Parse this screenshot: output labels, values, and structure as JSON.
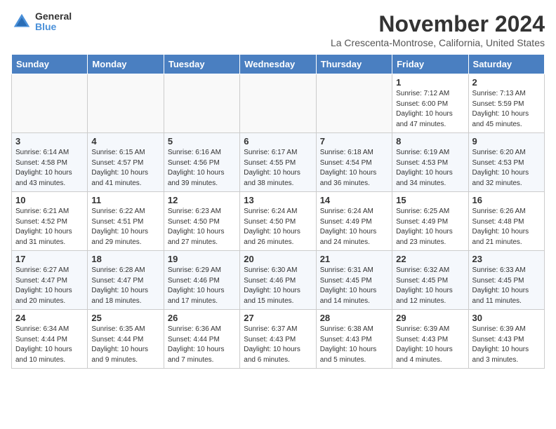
{
  "logo": {
    "general": "General",
    "blue": "Blue"
  },
  "title": "November 2024",
  "subtitle": "La Crescenta-Montrose, California, United States",
  "days_of_week": [
    "Sunday",
    "Monday",
    "Tuesday",
    "Wednesday",
    "Thursday",
    "Friday",
    "Saturday"
  ],
  "weeks": [
    [
      {
        "day": "",
        "info": ""
      },
      {
        "day": "",
        "info": ""
      },
      {
        "day": "",
        "info": ""
      },
      {
        "day": "",
        "info": ""
      },
      {
        "day": "",
        "info": ""
      },
      {
        "day": "1",
        "info": "Sunrise: 7:12 AM\nSunset: 6:00 PM\nDaylight: 10 hours\nand 47 minutes."
      },
      {
        "day": "2",
        "info": "Sunrise: 7:13 AM\nSunset: 5:59 PM\nDaylight: 10 hours\nand 45 minutes."
      }
    ],
    [
      {
        "day": "3",
        "info": "Sunrise: 6:14 AM\nSunset: 4:58 PM\nDaylight: 10 hours\nand 43 minutes."
      },
      {
        "day": "4",
        "info": "Sunrise: 6:15 AM\nSunset: 4:57 PM\nDaylight: 10 hours\nand 41 minutes."
      },
      {
        "day": "5",
        "info": "Sunrise: 6:16 AM\nSunset: 4:56 PM\nDaylight: 10 hours\nand 39 minutes."
      },
      {
        "day": "6",
        "info": "Sunrise: 6:17 AM\nSunset: 4:55 PM\nDaylight: 10 hours\nand 38 minutes."
      },
      {
        "day": "7",
        "info": "Sunrise: 6:18 AM\nSunset: 4:54 PM\nDaylight: 10 hours\nand 36 minutes."
      },
      {
        "day": "8",
        "info": "Sunrise: 6:19 AM\nSunset: 4:53 PM\nDaylight: 10 hours\nand 34 minutes."
      },
      {
        "day": "9",
        "info": "Sunrise: 6:20 AM\nSunset: 4:53 PM\nDaylight: 10 hours\nand 32 minutes."
      }
    ],
    [
      {
        "day": "10",
        "info": "Sunrise: 6:21 AM\nSunset: 4:52 PM\nDaylight: 10 hours\nand 31 minutes."
      },
      {
        "day": "11",
        "info": "Sunrise: 6:22 AM\nSunset: 4:51 PM\nDaylight: 10 hours\nand 29 minutes."
      },
      {
        "day": "12",
        "info": "Sunrise: 6:23 AM\nSunset: 4:50 PM\nDaylight: 10 hours\nand 27 minutes."
      },
      {
        "day": "13",
        "info": "Sunrise: 6:24 AM\nSunset: 4:50 PM\nDaylight: 10 hours\nand 26 minutes."
      },
      {
        "day": "14",
        "info": "Sunrise: 6:24 AM\nSunset: 4:49 PM\nDaylight: 10 hours\nand 24 minutes."
      },
      {
        "day": "15",
        "info": "Sunrise: 6:25 AM\nSunset: 4:49 PM\nDaylight: 10 hours\nand 23 minutes."
      },
      {
        "day": "16",
        "info": "Sunrise: 6:26 AM\nSunset: 4:48 PM\nDaylight: 10 hours\nand 21 minutes."
      }
    ],
    [
      {
        "day": "17",
        "info": "Sunrise: 6:27 AM\nSunset: 4:47 PM\nDaylight: 10 hours\nand 20 minutes."
      },
      {
        "day": "18",
        "info": "Sunrise: 6:28 AM\nSunset: 4:47 PM\nDaylight: 10 hours\nand 18 minutes."
      },
      {
        "day": "19",
        "info": "Sunrise: 6:29 AM\nSunset: 4:46 PM\nDaylight: 10 hours\nand 17 minutes."
      },
      {
        "day": "20",
        "info": "Sunrise: 6:30 AM\nSunset: 4:46 PM\nDaylight: 10 hours\nand 15 minutes."
      },
      {
        "day": "21",
        "info": "Sunrise: 6:31 AM\nSunset: 4:45 PM\nDaylight: 10 hours\nand 14 minutes."
      },
      {
        "day": "22",
        "info": "Sunrise: 6:32 AM\nSunset: 4:45 PM\nDaylight: 10 hours\nand 12 minutes."
      },
      {
        "day": "23",
        "info": "Sunrise: 6:33 AM\nSunset: 4:45 PM\nDaylight: 10 hours\nand 11 minutes."
      }
    ],
    [
      {
        "day": "24",
        "info": "Sunrise: 6:34 AM\nSunset: 4:44 PM\nDaylight: 10 hours\nand 10 minutes."
      },
      {
        "day": "25",
        "info": "Sunrise: 6:35 AM\nSunset: 4:44 PM\nDaylight: 10 hours\nand 9 minutes."
      },
      {
        "day": "26",
        "info": "Sunrise: 6:36 AM\nSunset: 4:44 PM\nDaylight: 10 hours\nand 7 minutes."
      },
      {
        "day": "27",
        "info": "Sunrise: 6:37 AM\nSunset: 4:43 PM\nDaylight: 10 hours\nand 6 minutes."
      },
      {
        "day": "28",
        "info": "Sunrise: 6:38 AM\nSunset: 4:43 PM\nDaylight: 10 hours\nand 5 minutes."
      },
      {
        "day": "29",
        "info": "Sunrise: 6:39 AM\nSunset: 4:43 PM\nDaylight: 10 hours\nand 4 minutes."
      },
      {
        "day": "30",
        "info": "Sunrise: 6:39 AM\nSunset: 4:43 PM\nDaylight: 10 hours\nand 3 minutes."
      }
    ]
  ]
}
